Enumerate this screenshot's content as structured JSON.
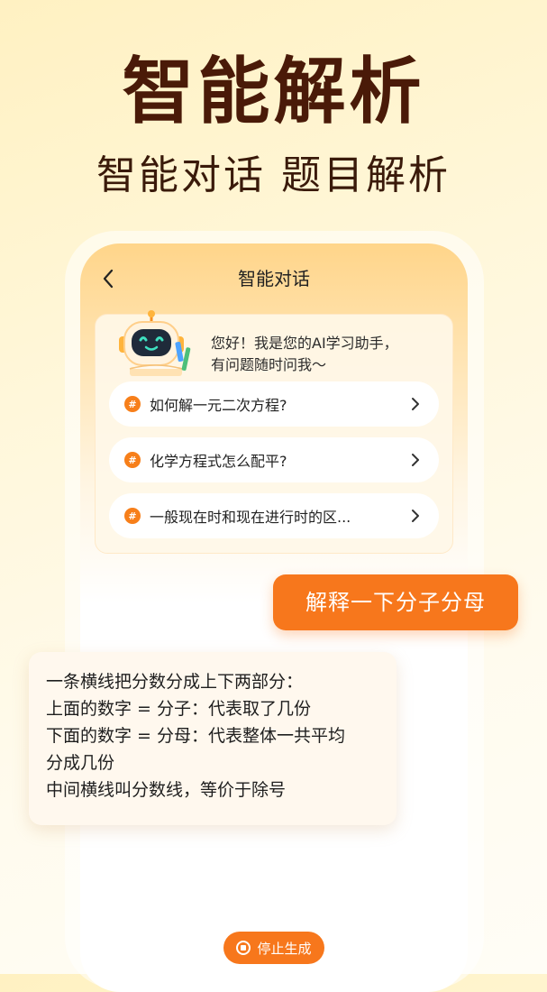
{
  "headline": "智能解析",
  "subline": "智能对话 题目解析",
  "phone": {
    "nav_title": "智能对话",
    "back_icon": "chevron-left-icon",
    "greeting_line1": "您好！我是您的AI学习助手，",
    "greeting_line2": "有问题随时问我～",
    "suggestions": [
      {
        "badge": "#",
        "text": "如何解一元二次方程?"
      },
      {
        "badge": "#",
        "text": "化学方程式怎么配平?"
      },
      {
        "badge": "#",
        "text": "一般现在时和现在进行时的区..."
      }
    ],
    "user_message": "解释一下分子分母",
    "ai_reply_lines": [
      "一条横线把分数分成上下两部分：",
      "上面的数字 = 分子：代表取了几份",
      "下面的数字 = 分母：代表整体一共平均",
      "分成几份",
      "中间横线叫分数线，等价于除号"
    ],
    "stop_label": "停止生成"
  },
  "colors": {
    "accent": "#f7771c",
    "headline": "#4a1a08",
    "card_bg": "#fff7e8"
  }
}
